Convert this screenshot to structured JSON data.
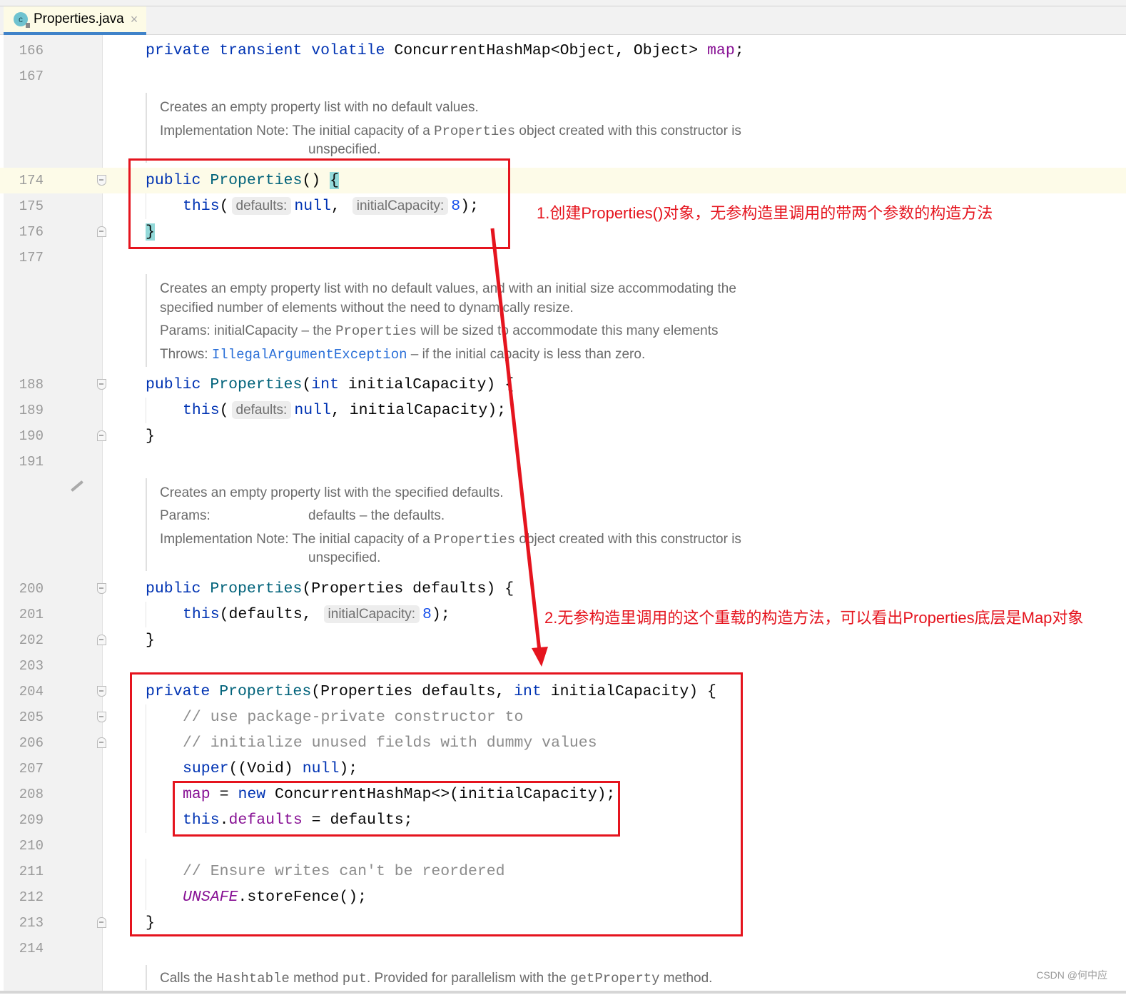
{
  "tab": {
    "label": "Properties.java",
    "icon": "class-icon",
    "icon_letter": "c",
    "close": "×"
  },
  "colors": {
    "keyword": "#0033b3",
    "method": "#00627a",
    "field": "#871094",
    "comment": "#8c8c8c",
    "number": "#1750eb",
    "annotation": "#e5141e"
  },
  "rows": [
    {
      "type": "code",
      "ln": "166",
      "tokens": [
        {
          "t": "private transient volatile ",
          "c": "kw"
        },
        {
          "t": "ConcurrentHashMap<Object, Object> "
        },
        {
          "t": "map",
          "c": "fld"
        },
        {
          "t": ";"
        }
      ]
    },
    {
      "type": "code",
      "ln": "167",
      "tokens": []
    },
    {
      "type": "doc",
      "cls": "d1",
      "paras": [
        {
          "segs": [
            {
              "t": "Creates an empty property list with no default values."
            }
          ]
        },
        {
          "segs": [
            {
              "t": "Implementation Note: The initial capacity of a "
            },
            {
              "t": "Properties",
              "c": "c"
            },
            {
              "t": " object created with this constructor is"
            }
          ],
          "cont": "unspecified."
        }
      ]
    },
    {
      "type": "code",
      "ln": "174",
      "hl": true,
      "fold": "start",
      "tokens": [
        {
          "t": "public ",
          "c": "kw"
        },
        {
          "t": "Properties",
          "c": "fn"
        },
        {
          "t": "() "
        },
        {
          "t": "{",
          "c": "brace"
        }
      ]
    },
    {
      "type": "code",
      "ln": "175",
      "indent": true,
      "tokens": [
        {
          "t": "this",
          "c": "kw"
        },
        {
          "t": "("
        },
        {
          "t": "defaults:",
          "c": "hint"
        },
        {
          "t": "null",
          "c": "kw"
        },
        {
          "t": ", "
        },
        {
          "t": "initialCapacity:",
          "c": "hint"
        },
        {
          "t": "8",
          "c": "num"
        },
        {
          "t": ");"
        }
      ]
    },
    {
      "type": "code",
      "ln": "176",
      "fold": "end",
      "tokens": [
        {
          "t": "}",
          "c": "brace"
        }
      ]
    },
    {
      "type": "code",
      "ln": "177",
      "tokens": []
    },
    {
      "type": "doc",
      "cls": "d2",
      "paras": [
        {
          "segs": [
            {
              "t": "Creates an empty property list with no default values, and with an initial size accommodating the"
            }
          ]
        },
        {
          "segs": [
            {
              "t": "specified number of elements without the need to dynamically resize."
            }
          ]
        },
        {
          "segs": [
            {
              "t": "Params: initialCapacity – the "
            },
            {
              "t": "Properties",
              "c": "c"
            },
            {
              "t": " will be sized to accommodate this many elements"
            }
          ]
        },
        {
          "segs": [
            {
              "t": "Throws: "
            },
            {
              "t": "IllegalArgumentException",
              "c": "lnk"
            },
            {
              "t": " – if the initial capacity is less than zero."
            }
          ]
        }
      ]
    },
    {
      "type": "code",
      "ln": "188",
      "fold": "start",
      "tokens": [
        {
          "t": "public ",
          "c": "kw"
        },
        {
          "t": "Properties",
          "c": "fn"
        },
        {
          "t": "("
        },
        {
          "t": "int ",
          "c": "kw"
        },
        {
          "t": "initialCapacity) {"
        }
      ]
    },
    {
      "type": "code",
      "ln": "189",
      "indent": true,
      "tokens": [
        {
          "t": "this",
          "c": "kw"
        },
        {
          "t": "("
        },
        {
          "t": "defaults:",
          "c": "hint"
        },
        {
          "t": "null",
          "c": "kw"
        },
        {
          "t": ", initialCapacity);"
        }
      ]
    },
    {
      "type": "code",
      "ln": "190",
      "fold": "end",
      "tokens": [
        {
          "t": "}"
        }
      ]
    },
    {
      "type": "code",
      "ln": "191",
      "tokens": []
    },
    {
      "type": "doc",
      "cls": "d3",
      "pencil": true,
      "paras": [
        {
          "segs": [
            {
              "t": "Creates an empty property list with the specified defaults."
            }
          ]
        },
        {
          "segs": [
            {
              "t": "Params:"
            }
          ],
          "cont": "defaults – the defaults."
        },
        {
          "segs": [
            {
              "t": "Implementation Note: The initial capacity of a "
            },
            {
              "t": "Properties",
              "c": "c"
            },
            {
              "t": " object created with this constructor is"
            }
          ],
          "cont": "unspecified."
        }
      ]
    },
    {
      "type": "code",
      "ln": "200",
      "fold": "start",
      "tokens": [
        {
          "t": "public ",
          "c": "kw"
        },
        {
          "t": "Properties",
          "c": "fn"
        },
        {
          "t": "(Properties defaults) {"
        }
      ]
    },
    {
      "type": "code",
      "ln": "201",
      "indent": true,
      "tokens": [
        {
          "t": "this",
          "c": "kw"
        },
        {
          "t": "(defaults, "
        },
        {
          "t": "initialCapacity:",
          "c": "hint"
        },
        {
          "t": "8",
          "c": "num"
        },
        {
          "t": ");"
        }
      ]
    },
    {
      "type": "code",
      "ln": "202",
      "fold": "end",
      "tokens": [
        {
          "t": "}"
        }
      ]
    },
    {
      "type": "code",
      "ln": "203",
      "tokens": []
    },
    {
      "type": "code",
      "ln": "204",
      "fold": "start",
      "tokens": [
        {
          "t": "private ",
          "c": "kw"
        },
        {
          "t": "Properties",
          "c": "fn"
        },
        {
          "t": "(Properties defaults, "
        },
        {
          "t": "int ",
          "c": "kw"
        },
        {
          "t": "initialCapacity) {"
        }
      ]
    },
    {
      "type": "code",
      "ln": "205",
      "indent": true,
      "fold": "start",
      "tokens": [
        {
          "t": "// use package-private constructor to",
          "c": "cm"
        }
      ]
    },
    {
      "type": "code",
      "ln": "206",
      "indent": true,
      "fold": "end",
      "tokens": [
        {
          "t": "// initialize unused fields with dummy values",
          "c": "cm"
        }
      ]
    },
    {
      "type": "code",
      "ln": "207",
      "indent": true,
      "tokens": [
        {
          "t": "super",
          "c": "kw"
        },
        {
          "t": "((Void) "
        },
        {
          "t": "null",
          "c": "kw"
        },
        {
          "t": ");"
        }
      ]
    },
    {
      "type": "code",
      "ln": "208",
      "indent": true,
      "tokens": [
        {
          "t": "map",
          "c": "fld"
        },
        {
          "t": " = "
        },
        {
          "t": "new ",
          "c": "kw"
        },
        {
          "t": "ConcurrentHashMap<>(initialCapacity);"
        }
      ]
    },
    {
      "type": "code",
      "ln": "209",
      "indent": true,
      "tokens": [
        {
          "t": "this",
          "c": "kw"
        },
        {
          "t": "."
        },
        {
          "t": "defaults",
          "c": "fld"
        },
        {
          "t": " = defaults;"
        }
      ]
    },
    {
      "type": "code",
      "ln": "210",
      "tokens": []
    },
    {
      "type": "code",
      "ln": "211",
      "indent": true,
      "tokens": [
        {
          "t": "// Ensure writes can't be reordered",
          "c": "cm"
        }
      ]
    },
    {
      "type": "code",
      "ln": "212",
      "indent": true,
      "tokens": [
        {
          "t": "UNSAFE",
          "c": "it"
        },
        {
          "t": ".storeFence();"
        }
      ]
    },
    {
      "type": "code",
      "ln": "213",
      "fold": "end",
      "tokens": [
        {
          "t": "}"
        }
      ]
    },
    {
      "type": "code",
      "ln": "214",
      "tokens": []
    },
    {
      "type": "doc",
      "cls": "d4",
      "paras": [
        {
          "segs": [
            {
              "t": "Calls the "
            },
            {
              "t": "Hashtable",
              "c": "c"
            },
            {
              "t": " method "
            },
            {
              "t": "put",
              "c": "c"
            },
            {
              "t": ". Provided for parallelism with the "
            },
            {
              "t": "getProperty",
              "c": "c"
            },
            {
              "t": " method."
            }
          ]
        }
      ]
    }
  ],
  "annotations": {
    "note1": "1.创建Properties()对象，无参构造里调用的带两个参数的构造方法",
    "note2": "2.无参构造里调用的这个重载的构造方法，可以看出Properties底层是Map对象"
  },
  "watermark": "CSDN @何中应"
}
